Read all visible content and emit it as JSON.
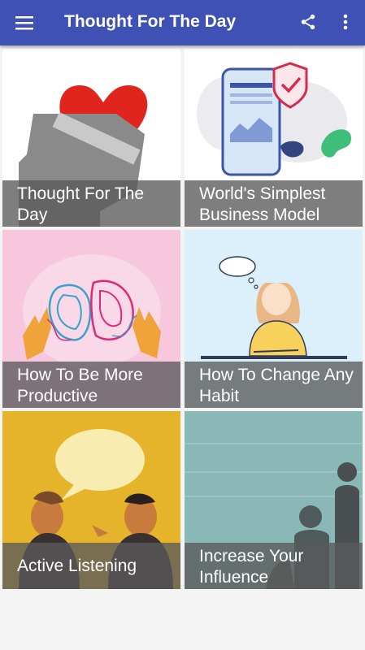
{
  "app": {
    "title": "Thought For The Day"
  },
  "cards": [
    {
      "label": "Thought For The Day"
    },
    {
      "label": "World's Simplest Business Model"
    },
    {
      "label": "How To Be More Productive"
    },
    {
      "label": "How To Change Any Habit"
    },
    {
      "label": "Active Listening"
    },
    {
      "label": "Increase Your Influence"
    }
  ],
  "colors": {
    "appbar": "#3f51b5",
    "caption_overlay": "#5a5a5a",
    "heart_red": "#e0251f",
    "productive_bg": "#f7c8dd",
    "habit_bg": "#dcf0fb",
    "listening_bg": "#e6b42a",
    "influence_bg": "#8ab8b6"
  },
  "icons": [
    "hamburger-menu-icon",
    "share-icon",
    "more-vert-icon"
  ]
}
